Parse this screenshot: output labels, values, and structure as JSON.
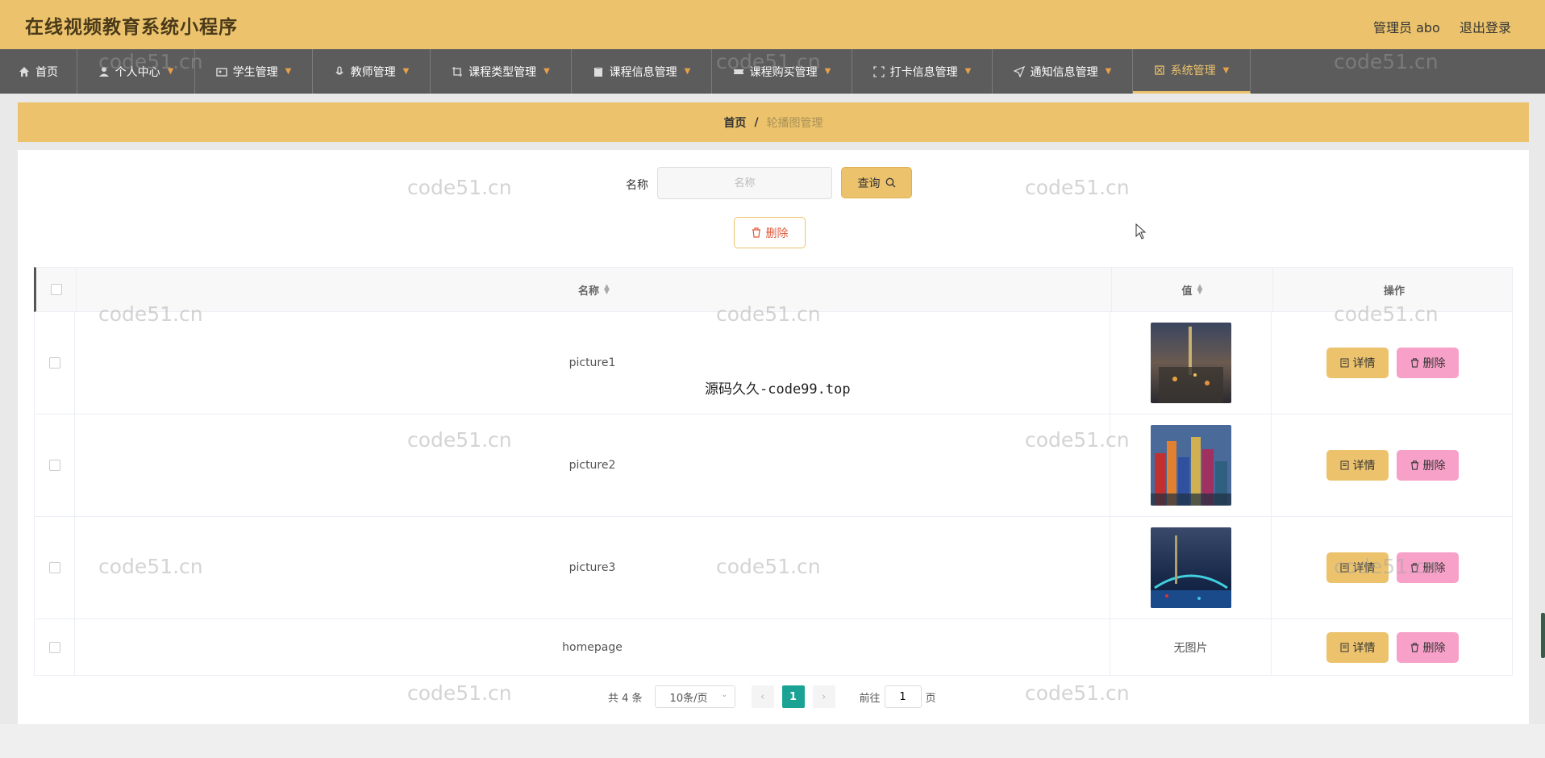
{
  "header": {
    "app_title": "在线视频教育系统小程序",
    "admin_user": "管理员 abo",
    "logout_label": "退出登录",
    "background_color": "#ecc36c"
  },
  "nav": {
    "items": [
      {
        "label": "首页",
        "icon": "home-icon"
      },
      {
        "label": "个人中心",
        "icon": "user-icon"
      },
      {
        "label": "学生管理",
        "icon": "id-card-icon"
      },
      {
        "label": "教师管理",
        "icon": "microphone-icon"
      },
      {
        "label": "课程类型管理",
        "icon": "crop-icon"
      },
      {
        "label": "课程信息管理",
        "icon": "clipboard-icon"
      },
      {
        "label": "课程购买管理",
        "icon": "ticket-icon"
      },
      {
        "label": "打卡信息管理",
        "icon": "fullscreen-icon"
      },
      {
        "label": "通知信息管理",
        "icon": "send-icon"
      },
      {
        "label": "系统管理",
        "icon": "setting-icon"
      }
    ],
    "active_index": 9
  },
  "breadcrumb": {
    "home": "首页",
    "separator": "/",
    "current": "轮播图管理"
  },
  "search": {
    "label": "名称",
    "placeholder": "名称",
    "value": "",
    "button_label": "查询"
  },
  "bulk_delete_label": "删除",
  "table": {
    "columns": {
      "name": "名称",
      "value": "值",
      "actions": "操作"
    },
    "rows": [
      {
        "name": "picture1",
        "thumb": "city-tower-night",
        "value_text": ""
      },
      {
        "name": "picture2",
        "thumb": "colorful-buildings",
        "value_text": ""
      },
      {
        "name": "picture3",
        "thumb": "bridge-night",
        "value_text": ""
      },
      {
        "name": "homepage",
        "thumb": "",
        "value_text": "无图片"
      }
    ],
    "detail_label": "详情",
    "delete_label": "删除"
  },
  "pagination": {
    "total_text": "共 4 条",
    "page_size": "10条/页",
    "prev": "‹",
    "current_page": "1",
    "next": "›",
    "goto_label": "前往",
    "goto_value": "1",
    "page_suffix": "页"
  },
  "overlay_text": "源码久久-code99.top",
  "watermark": "code51.cn"
}
